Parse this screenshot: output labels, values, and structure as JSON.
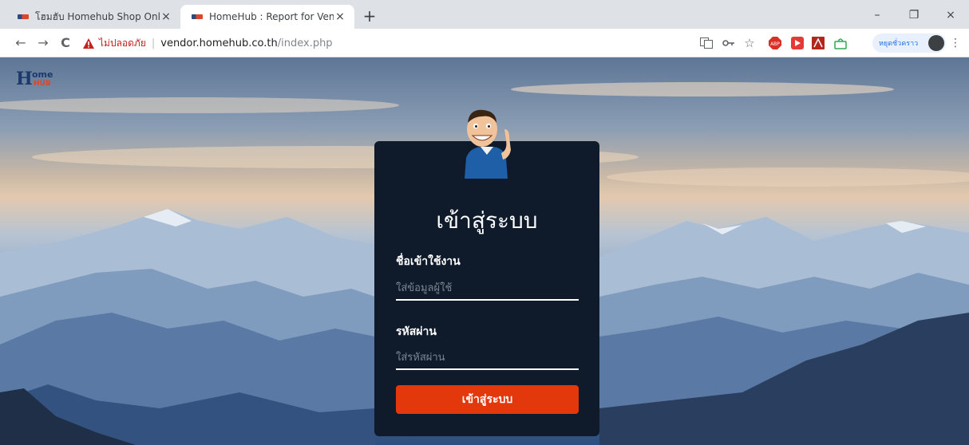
{
  "browser": {
    "tabs": [
      {
        "title": "โฮมฮับ Homehub Shop Online",
        "close": "×"
      },
      {
        "title": "HomeHub : Report for Vendor",
        "close": "×"
      }
    ],
    "new_tab": "+",
    "window_controls": {
      "minimize": "–",
      "restore": "❐",
      "close": "×"
    },
    "nav": {
      "back": "←",
      "forward": "→",
      "reload": "C"
    },
    "address": {
      "security_text": "ไม่ปลอดภัย",
      "separator": "|",
      "host": "vendor.homehub.co.th",
      "path": "/index.php"
    },
    "profile_label": "หยุดชั่วคราว",
    "menu": "⋮",
    "toolbar_icons": [
      "translate-icon",
      "key-icon",
      "star-icon",
      "adblock-icon",
      "media-icon",
      "acrobat-icon",
      "extension-icon"
    ]
  },
  "page": {
    "logo_text": "Home HUB",
    "login": {
      "title": "เข้าสู่ระบบ",
      "username_label": "ชื่อเข้าใช้งาน",
      "username_placeholder": "ใส่ข้อมูลผู้ใช้",
      "password_label": "รหัสผ่าน",
      "password_placeholder": "ใส่รหัสผ่าน",
      "submit": "เข้าสู่ระบบ"
    }
  },
  "colors": {
    "card_bg": "#0f1a2a",
    "button_bg": "#e3370c",
    "insecure_red": "#c5221f"
  }
}
